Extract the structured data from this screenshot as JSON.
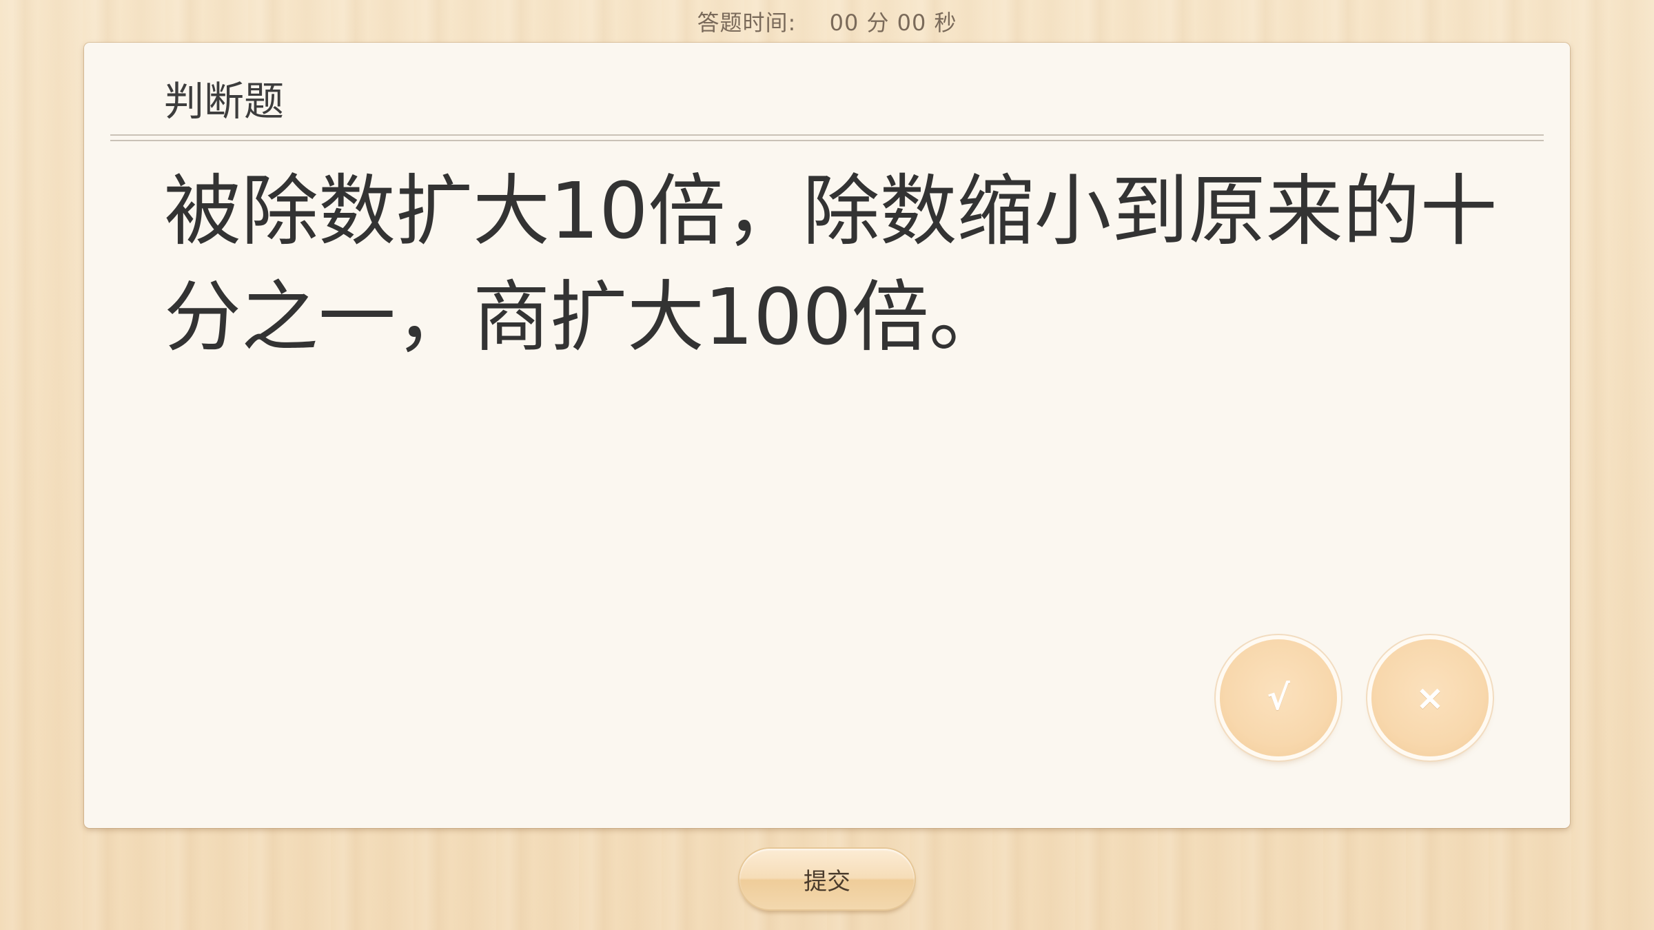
{
  "timer": {
    "label": "答题时间:",
    "minutes": "00",
    "minutes_unit": "分",
    "seconds": "00",
    "seconds_unit": "秒"
  },
  "question": {
    "type_label": "判断题",
    "text": "被除数扩大10倍，除数缩小到原来的十分之一，商扩大100倍。"
  },
  "answers": {
    "true_symbol": "√",
    "false_symbol": "×"
  },
  "submit": {
    "label": "提交"
  },
  "colors": {
    "card_background": "#fbf7f0",
    "answer_button": "#f8d8ad",
    "wood_background": "#f6e2c4"
  }
}
